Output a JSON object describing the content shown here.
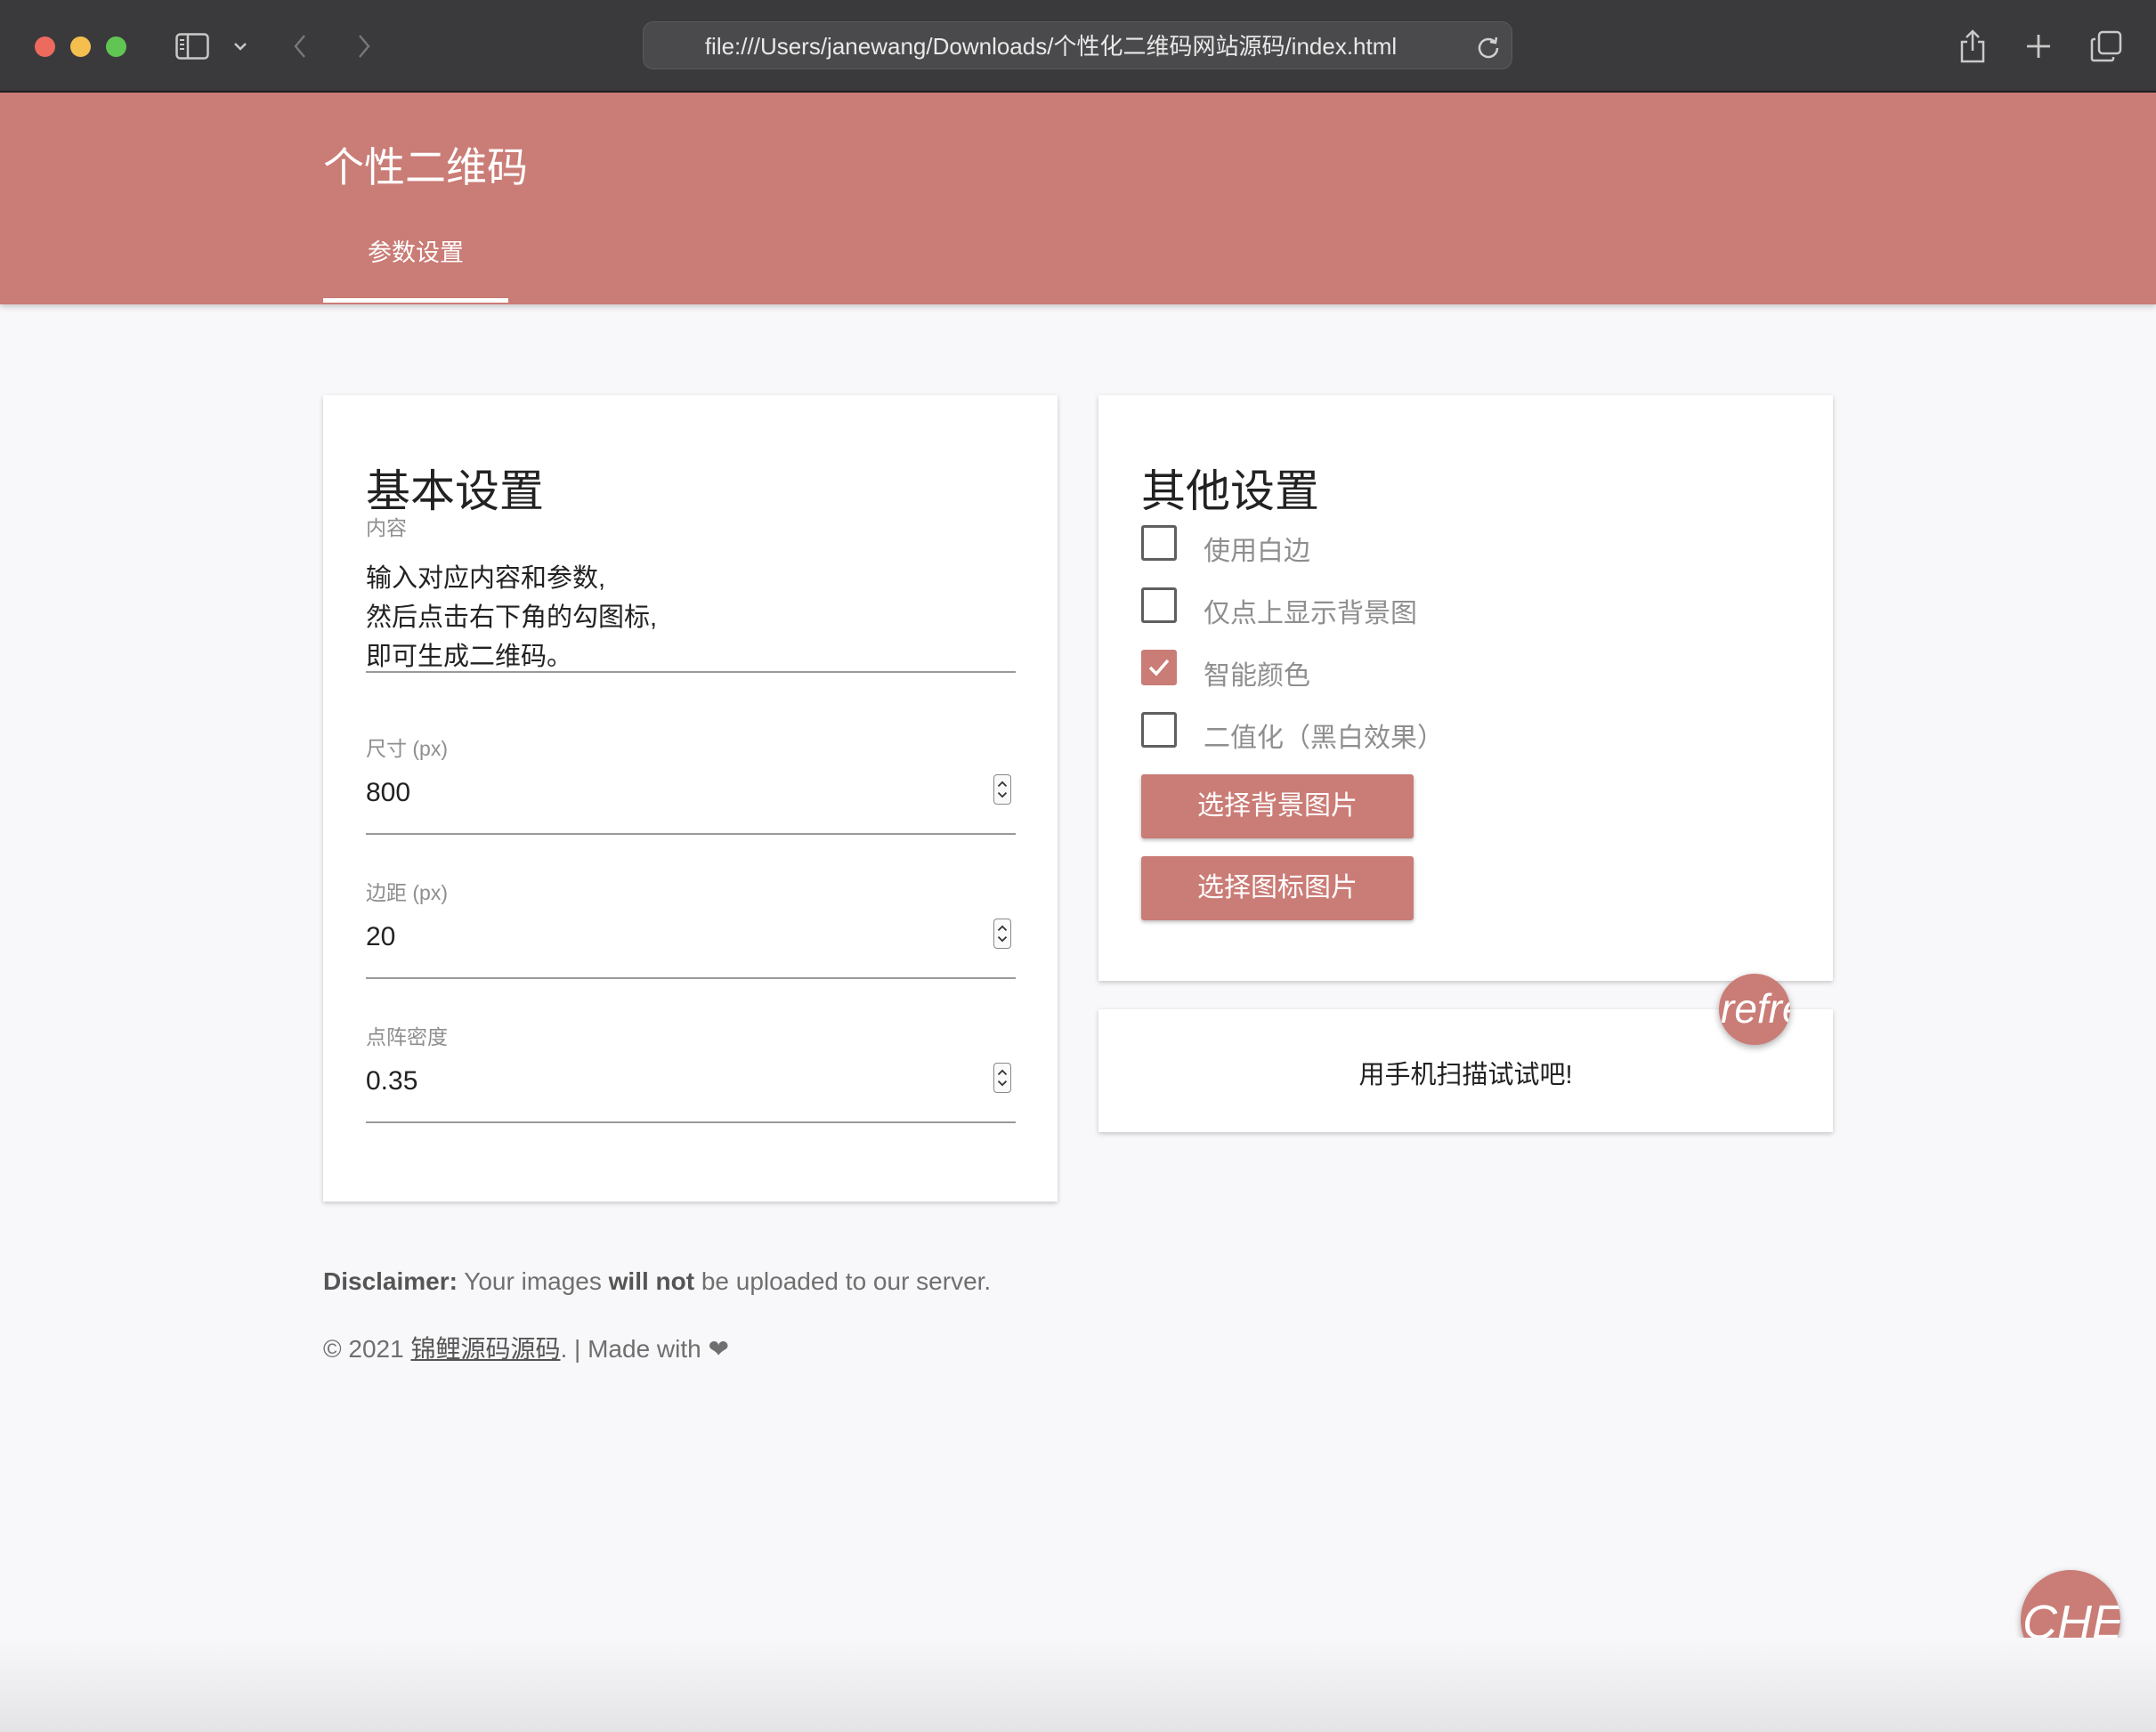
{
  "browser": {
    "url": "file:///Users/janewang/Downloads/个性化二维码网站源码/index.html"
  },
  "header": {
    "title": "个性二维码",
    "tab": "参数设置",
    "color": "#ca7c76"
  },
  "basic": {
    "title": "基本设置",
    "content_label": "内容",
    "content_lines": [
      "输入对应内容和参数,",
      "然后点击右下角的勾图标,",
      "即可生成二维码。"
    ],
    "size_label": "尺寸 (px)",
    "size_value": "800",
    "margin_label": "边距 (px)",
    "margin_value": "20",
    "density_label": "点阵密度",
    "density_value": "0.35"
  },
  "other": {
    "title": "其他设置",
    "options": [
      {
        "label": "使用白边",
        "checked": false
      },
      {
        "label": "仅点上显示背景图",
        "checked": false
      },
      {
        "label": "智能颜色",
        "checked": true
      },
      {
        "label": "二值化（黑白效果）",
        "checked": false
      }
    ],
    "btn_bg": "选择背景图片",
    "btn_icon": "选择图标图片"
  },
  "result": {
    "text": "用手机扫描试试吧!"
  },
  "fab": {
    "refresh": "refresh",
    "check": "CHECK"
  },
  "footer": {
    "disclaimer_bold": "Disclaimer:",
    "disclaimer_1": " Your images ",
    "disclaimer_bold2": "will not",
    "disclaimer_2": " be uploaded to our server.",
    "copyright": "© 2021 ",
    "link": "锦鲤源码源码",
    "made_with": ". | Made with ❤"
  }
}
